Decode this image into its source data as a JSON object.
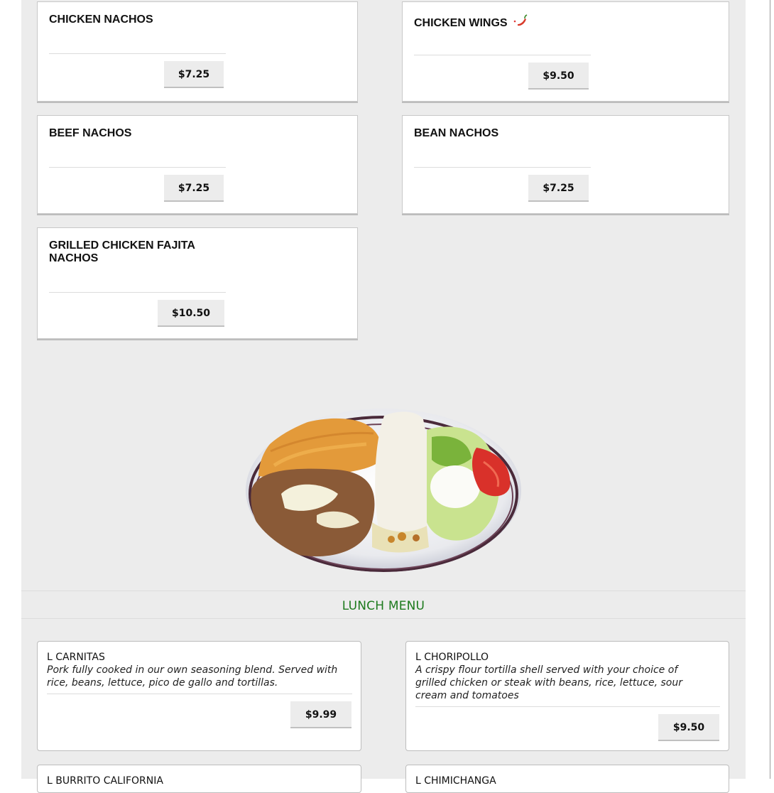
{
  "nachos_items": [
    {
      "name": "CHICKEN NACHOS",
      "price": "$7.25"
    },
    {
      "name": "CHICKEN WINGS",
      "price": "$9.50",
      "icon": "chili-pepper-icon"
    },
    {
      "name": "BEEF NACHOS",
      "price": "$7.25"
    },
    {
      "name": "BEAN NACHOS",
      "price": "$7.25"
    },
    {
      "name": "GRILLED CHICKEN FAJITA NACHOS",
      "price": "$10.50"
    }
  ],
  "section": {
    "title": "LUNCH MENU",
    "color": "#1d7a1d"
  },
  "lunch_items": [
    {
      "name": "L CARNITAS",
      "description": "Pork fully cooked in our own seasoning blend. Served with rice, beans, lettuce, pico de gallo and tortillas.",
      "price": "$9.99"
    },
    {
      "name": "L CHORIPOLLO",
      "description": "A crispy flour tortilla shell served with your choice of grilled chicken or steak with beans, rice, lettuce, sour cream and tomatoes",
      "price": "$9.50"
    },
    {
      "name": "L BURRITO CALIFORNIA"
    },
    {
      "name": "L CHIMICHANGA"
    }
  ],
  "colors": {
    "page_bg": "#ececec",
    "card_bg": "#ffffff",
    "button_bg": "#ececec"
  }
}
